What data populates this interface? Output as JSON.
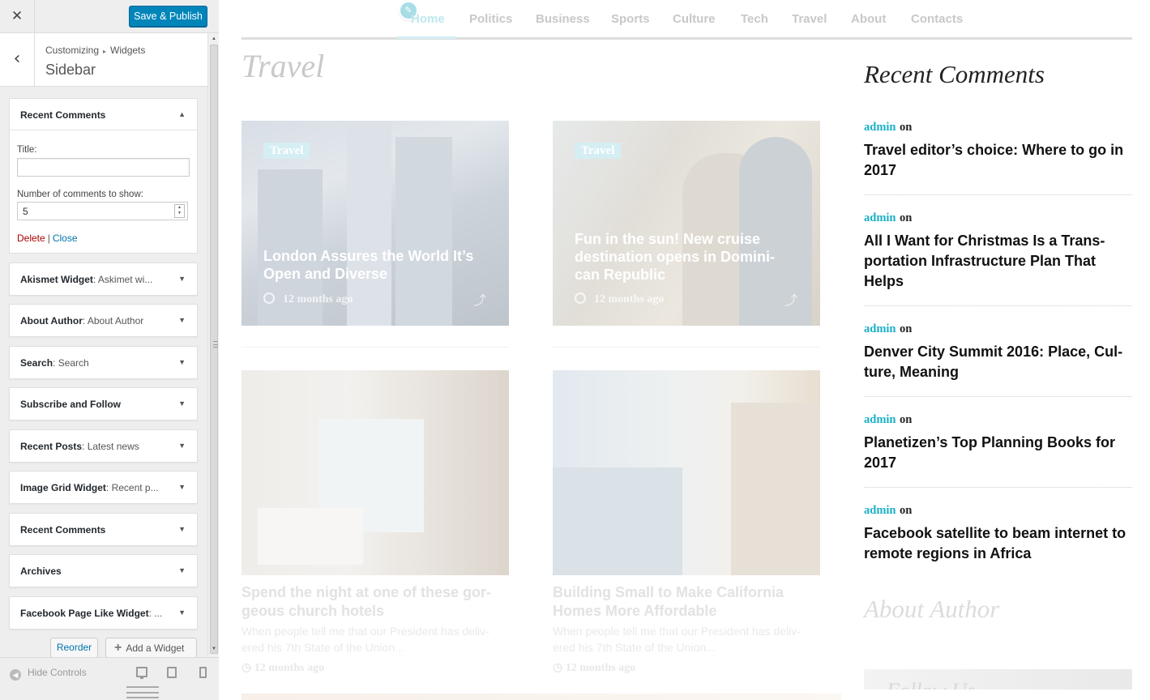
{
  "customizer": {
    "close_icon": "✕",
    "publish_label": "Save & Publish",
    "breadcrumb": {
      "first": "Customizing",
      "separator": "▸",
      "second": "Widgets"
    },
    "section_title": "Sidebar",
    "open_widget": {
      "title": "Recent Comments",
      "title_label": "Title:",
      "title_value": "",
      "count_label": "Number of comments to show:",
      "count_value": "5",
      "delete_label": "Delete",
      "separator": "|",
      "close_label": "Close"
    },
    "widgets": [
      {
        "name": "Akismet Widget",
        "subtitle": ": Askimet wi..."
      },
      {
        "name": "About Author",
        "subtitle": ": About Author"
      },
      {
        "name": "Search",
        "subtitle": ": Search"
      },
      {
        "name": "Subscribe and Follow",
        "subtitle": ""
      },
      {
        "name": "Recent Posts",
        "subtitle": ": Latest news"
      },
      {
        "name": "Image Grid Widget",
        "subtitle": ": Recent p..."
      },
      {
        "name": "Recent Comments",
        "subtitle": ""
      },
      {
        "name": "Archives",
        "subtitle": ""
      },
      {
        "name": "Facebook Page Like Widget",
        "subtitle": ": ..."
      }
    ],
    "reorder_label": "Reorder",
    "add_widget_label": "Add a Widget",
    "hide_controls_label": "Hide Controls"
  },
  "preview": {
    "nav": [
      "Home",
      "Politics",
      "Business",
      "Sports",
      "Culture",
      "Tech",
      "Travel",
      "About",
      "Contacts"
    ],
    "active_nav": "Home",
    "page_title": "Travel",
    "featured": [
      {
        "tag": "Travel",
        "title": "London Assures the World It’s Open and Diverse",
        "time": "12 months ago"
      },
      {
        "tag": "Travel",
        "title": "Fun in the sun! New cruise destination opens in Domini- can Republic",
        "time": "12 months ago"
      }
    ],
    "posts": [
      {
        "title": "Spend the night at one of these gor- geous church hotels",
        "excerpt": "When people tell me that our President has deliv- ered his 7th State of the Union...",
        "time": "12 months ago"
      },
      {
        "title": "Building Small to Make California Homes More Affordable",
        "excerpt": "When people tell me that our President has deliv- ered his 7th State of the Union...",
        "time": "12 months ago"
      }
    ],
    "sidebar": {
      "recent_title": "Recent Comments",
      "comments": [
        {
          "author": "admin",
          "on": "on",
          "title": "Travel editor’s choice: Where to go in 2017"
        },
        {
          "author": "admin",
          "on": "on",
          "title": "All I Want for Christmas Is a Trans- portation Infrastructure Plan That Helps"
        },
        {
          "author": "admin",
          "on": "on",
          "title": "Denver City Summit 2016: Place, Cul- ture, Meaning"
        },
        {
          "author": "admin",
          "on": "on",
          "title": "Planetizen’s Top Planning Books for 2017"
        },
        {
          "author": "admin",
          "on": "on",
          "title": "Facebook satellite to beam internet to remote regions in Africa"
        }
      ],
      "about_title": "About Author",
      "follow_title": "Follow Us"
    },
    "accent_color": "#1ab0c6"
  }
}
